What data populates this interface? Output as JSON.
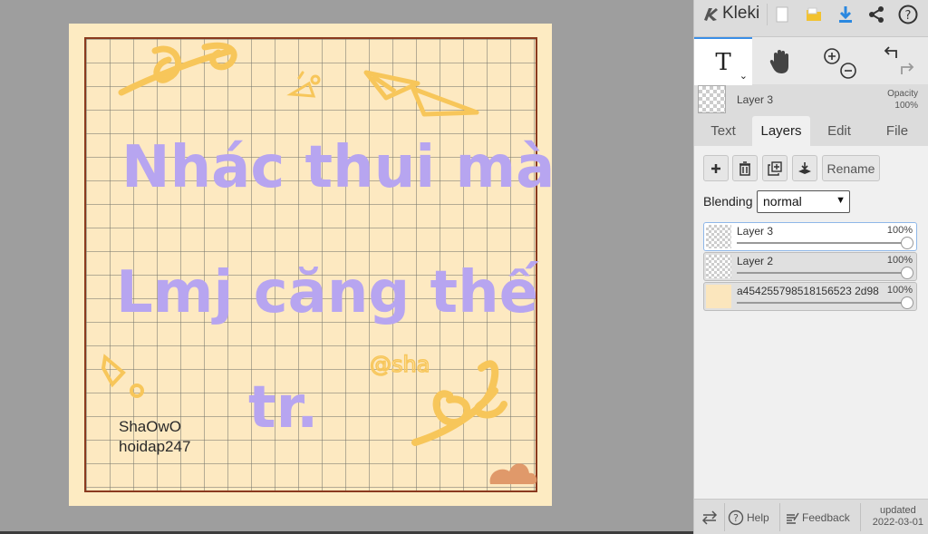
{
  "app": {
    "name": "Kleki"
  },
  "artwork": {
    "lines": [
      "Nhác thui mà.",
      "Lmj căng thế",
      "tr."
    ],
    "signature": "@sha",
    "credit_1": "ShaOwO",
    "credit_2": "hoidap247"
  },
  "header": {
    "current_layer": "Layer 3",
    "opacity_label": "Opacity",
    "opacity_value": "100%"
  },
  "tabs": [
    {
      "label": "Text",
      "active": false
    },
    {
      "label": "Layers",
      "active": true
    },
    {
      "label": "Edit",
      "active": false
    },
    {
      "label": "File",
      "active": false
    }
  ],
  "layers_panel": {
    "rename_label": "Rename",
    "blending_label": "Blending",
    "blending_value": "normal",
    "layers": [
      {
        "name": "Layer 3",
        "opacity": "100%",
        "selected": true
      },
      {
        "name": "Layer 2",
        "opacity": "100%",
        "selected": false
      },
      {
        "name": "a454255798518156523 2d98",
        "opacity": "100%",
        "selected": false
      }
    ]
  },
  "footer": {
    "help_label": "Help",
    "feedback_label": "Feedback",
    "updated_label": "updated",
    "updated_date": "2022-03-01"
  },
  "colors": {
    "accent": "#3a8ee6",
    "artwork_text": "#b7a5f0",
    "paper": "#fdebc2",
    "frame": "#8a3a1e",
    "doodle": "#f7c65a"
  }
}
